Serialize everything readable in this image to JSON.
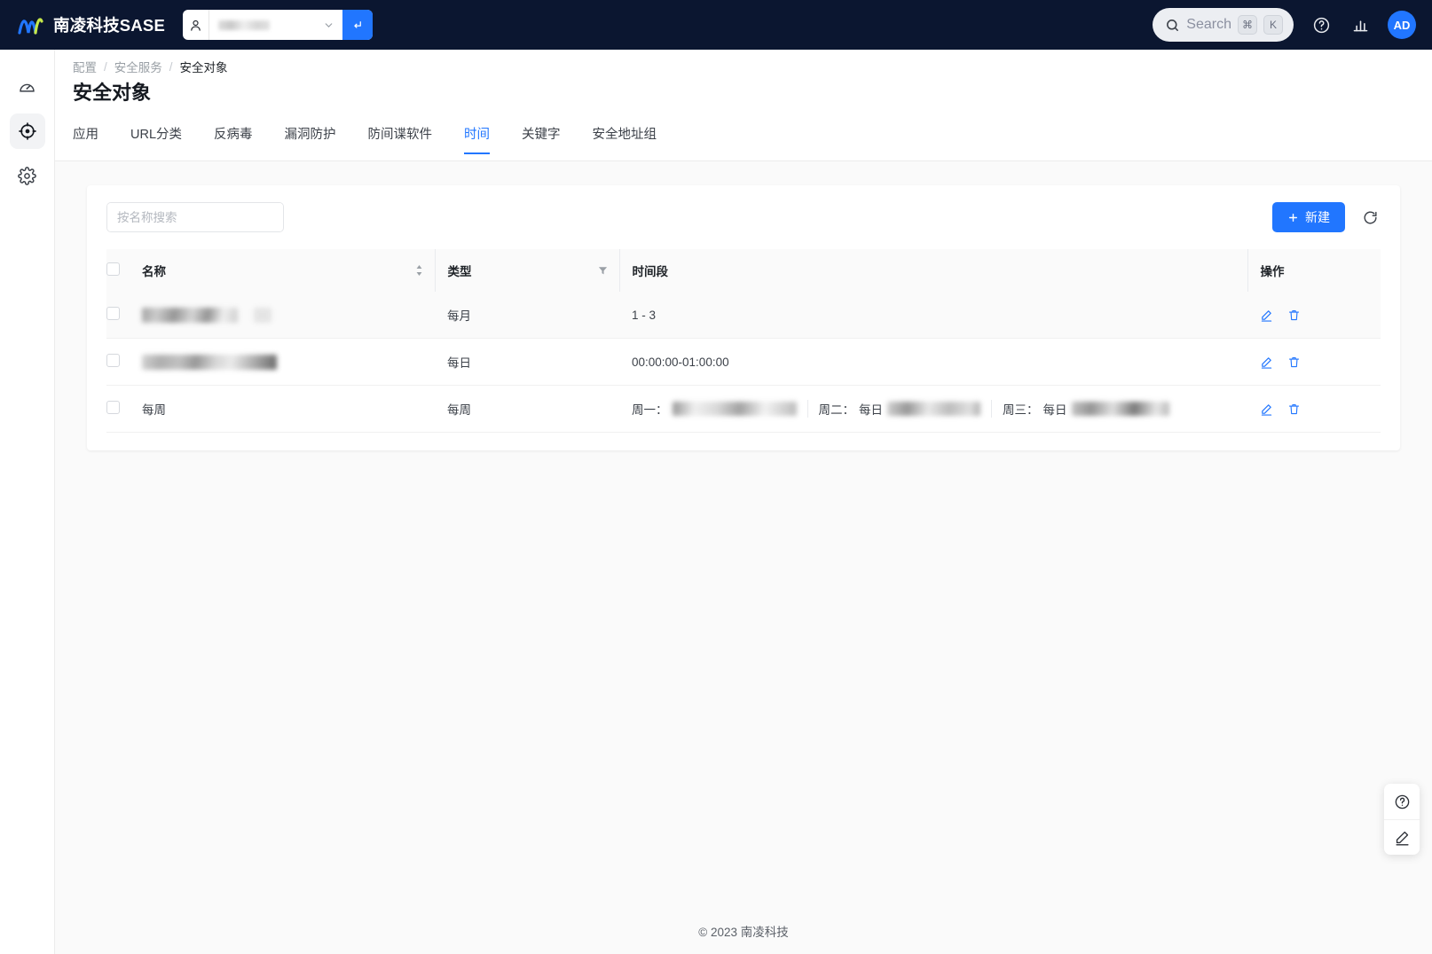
{
  "header": {
    "brand_name": "南凌科技SASE",
    "logo_icon": "nanling-logo-icon",
    "tenant": {
      "user_icon": "user-icon",
      "value": "",
      "caret_icon": "chevron-down-icon",
      "go_icon": "enter-arrow-icon"
    },
    "search": {
      "icon": "search-icon",
      "placeholder": "Search",
      "kbd_modifier": "⌘",
      "kbd_key": "K"
    },
    "help_icon": "question-circle-icon",
    "report_icon": "bar-chart-icon",
    "avatar_initials": "AD"
  },
  "sidebar": {
    "toggle_icon": "chevron-right-icon",
    "items": [
      {
        "icon": "dashboard-gauge-icon",
        "name": "dashboard",
        "active": false
      },
      {
        "icon": "target-crosshair-icon",
        "name": "security",
        "active": true
      },
      {
        "icon": "gear-icon",
        "name": "settings",
        "active": false
      }
    ]
  },
  "breadcrumb": {
    "items": [
      "配置",
      "安全服务",
      "安全对象"
    ],
    "separator": "/"
  },
  "page": {
    "title": "安全对象"
  },
  "tabs": [
    {
      "label": "应用",
      "active": false
    },
    {
      "label": "URL分类",
      "active": false
    },
    {
      "label": "反病毒",
      "active": false
    },
    {
      "label": "漏洞防护",
      "active": false
    },
    {
      "label": "防间谍软件",
      "active": false
    },
    {
      "label": "时间",
      "active": true
    },
    {
      "label": "关键字",
      "active": false
    },
    {
      "label": "安全地址组",
      "active": false
    }
  ],
  "toolbar": {
    "search_placeholder": "按名称搜索",
    "search_value": "",
    "search_icon": "search-icon",
    "new_label": "新建",
    "new_plus_icon": "plus-icon",
    "refresh_icon": "refresh-icon"
  },
  "table": {
    "columns": [
      {
        "key": "checkbox",
        "label": "",
        "icon": "checkbox-icon"
      },
      {
        "key": "name",
        "label": "名称",
        "tool_icon": "sort-arrows-icon"
      },
      {
        "key": "type",
        "label": "类型",
        "tool_icon": "filter-icon"
      },
      {
        "key": "timespan",
        "label": "时间段",
        "tool_icon": ""
      },
      {
        "key": "actions",
        "label": "操作",
        "tool_icon": ""
      }
    ],
    "rows": [
      {
        "name": "",
        "name_redacted": true,
        "type": "每月",
        "timespan": "1 - 3",
        "timespan_redacted": false,
        "hover": true
      },
      {
        "name": "",
        "name_redacted": true,
        "type": "每日",
        "timespan": "00:00:00-01:00:00",
        "timespan_redacted": false,
        "hover": false
      },
      {
        "name": "每周",
        "name_redacted": false,
        "type": "每周",
        "timespan": "",
        "timespan_redacted": true,
        "week_segments": [
          {
            "day": "周一：",
            "value": "",
            "redacted": true
          },
          {
            "day": "周二：",
            "value": "每日",
            "redacted": true
          },
          {
            "day": "周三：",
            "value": "每日",
            "redacted": true
          }
        ],
        "hover": false
      }
    ],
    "row_action_icons": [
      "edit-pencil-icon",
      "trash-delete-icon"
    ]
  },
  "float_widget": {
    "items": [
      {
        "icon": "question-circle-icon",
        "name": "help"
      },
      {
        "icon": "edit-pencil-icon",
        "name": "feedback"
      }
    ]
  },
  "footer": {
    "text": "© 2023 南凌科技"
  },
  "colors": {
    "accent": "#2176ff",
    "topbar_bg": "#0b1630",
    "body_bg": "#fafafa",
    "text_primary": "#1f2328",
    "text_muted": "#9aa0a6"
  }
}
